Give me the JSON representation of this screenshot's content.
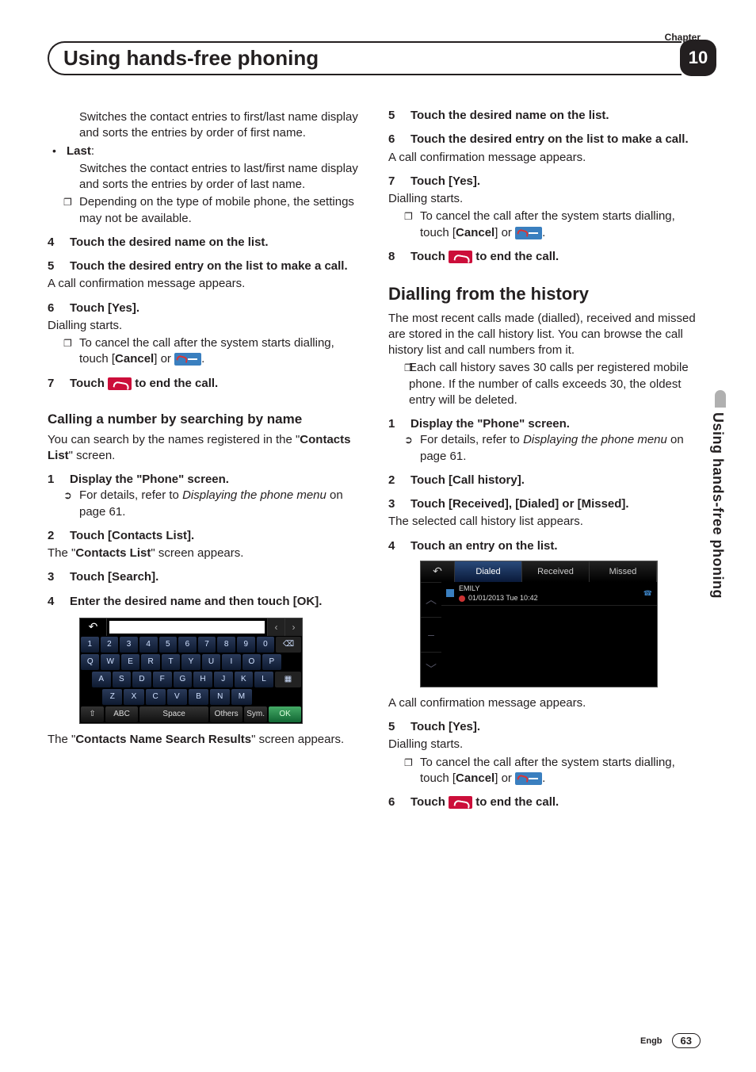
{
  "chapter_label": "Chapter",
  "chapter_number": "10",
  "page_title": "Using hands-free phoning",
  "side_tab": "Using hands-free phoning",
  "footer": {
    "lang": "Engb",
    "page": "63"
  },
  "left": {
    "p_first_switch": "Switches the contact entries to first/last name display and sorts the entries by order of first name.",
    "last_label": "Last",
    "p_last_switch": "Switches the contact entries to last/first name display and sorts the entries by order of last name.",
    "p_depending": "Depending on the type of mobile phone, the settings may not be available.",
    "s4": "Touch the desired name on the list.",
    "s5": "Touch the desired entry on the list to make a call.",
    "s5_body": "A call confirmation message appears.",
    "s6": "Touch [Yes].",
    "s6_body": "Dialling starts.",
    "s6_cancel_a": "To cancel the call after the system starts dialling, touch [",
    "s6_cancel_bold": "Cancel",
    "s6_cancel_b": "] or ",
    "s7_a": "Touch ",
    "s7_b": " to end the call.",
    "sub_search": "Calling a number by searching by name",
    "search_intro_a": "You can search by the names registered in the \"",
    "search_intro_bold": "Contacts List",
    "search_intro_b": "\" screen.",
    "ss1": "Display the \"Phone\" screen.",
    "ss1_ref_a": "For details, refer to ",
    "ss1_ref_i": "Displaying the phone menu",
    "ss1_ref_b": " on page 61.",
    "ss2": "Touch [Contacts List].",
    "ss2_body_a": "The \"",
    "ss2_body_bold": "Contacts List",
    "ss2_body_b": "\" screen appears.",
    "ss3": "Touch [Search].",
    "ss4": "Enter the desired name and then touch [OK].",
    "kbd": {
      "row1": [
        "1",
        "2",
        "3",
        "4",
        "5",
        "6",
        "7",
        "8",
        "9",
        "0"
      ],
      "row2": [
        "Q",
        "W",
        "E",
        "R",
        "T",
        "Y",
        "U",
        "I",
        "O",
        "P"
      ],
      "row3": [
        "A",
        "S",
        "D",
        "F",
        "G",
        "H",
        "J",
        "K",
        "L"
      ],
      "row4": [
        "Z",
        "X",
        "C",
        "V",
        "B",
        "N",
        "M"
      ],
      "row5": [
        "⇧",
        "ABC",
        "Space",
        "Others",
        "Sym.",
        "OK"
      ]
    },
    "after_kbd_a": "The \"",
    "after_kbd_bold": "Contacts Name Search Results",
    "after_kbd_b": "\" screen appears."
  },
  "right": {
    "s5": "Touch the desired name on the list.",
    "s6": "Touch the desired entry on the list to make a call.",
    "s6_body": "A call confirmation message appears.",
    "s7": "Touch [Yes].",
    "s7_body": "Dialling starts.",
    "s7_cancel_a": "To cancel the call after the system starts dialling, touch [",
    "s7_cancel_bold": "Cancel",
    "s7_cancel_b": "] or ",
    "s8_a": "Touch ",
    "s8_b": " to end the call.",
    "section": "Dialling from the history",
    "intro": "The most recent calls made (dialled), received and missed are stored in the call history list. You can browse the call history list and call numbers from it.",
    "note": "Each call history saves 30 calls per registered mobile phone. If the number of calls exceeds 30, the oldest entry will be deleted.",
    "h1": "Display the \"Phone\" screen.",
    "h1_ref_a": "For details, refer to ",
    "h1_ref_i": "Displaying the phone menu",
    "h1_ref_b": " on page 61.",
    "h2": "Touch [Call history].",
    "h3": "Touch [Received], [Dialed] or [Missed].",
    "h3_body": "The selected call history list appears.",
    "h4": "Touch an entry on the list.",
    "hist": {
      "tabs": [
        "Dialed",
        "Received",
        "Missed"
      ],
      "entry_name": "EMILY",
      "entry_time": "01/01/2013  Tue  10:42"
    },
    "h4_after": "A call confirmation message appears.",
    "h5": "Touch [Yes].",
    "h5_body": "Dialling starts.",
    "h5_cancel_a": "To cancel the call after the system starts dialling, touch [",
    "h5_cancel_bold": "Cancel",
    "h5_cancel_b": "] or ",
    "h6_a": "Touch ",
    "h6_b": " to end the call."
  }
}
